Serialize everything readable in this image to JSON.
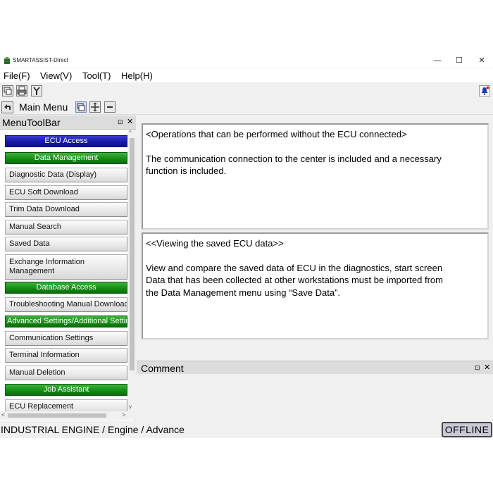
{
  "window": {
    "title": "SMARTASSIST-Direct",
    "controls": {
      "minimize": "—",
      "maximize": "☐",
      "close": "✕"
    }
  },
  "menubar": {
    "items": [
      "File(F)",
      "View(V)",
      "Tool(T)",
      "Help(H)"
    ]
  },
  "toolbar": {
    "main_menu_label": "Main Menu"
  },
  "menu_toolbar": {
    "title": "MenuToolBar",
    "items": [
      {
        "label": "ECU Access",
        "style": "blue"
      },
      {
        "label": "Data Management",
        "style": "green"
      },
      {
        "label": "Diagnostic Data (Display)",
        "style": "grey"
      },
      {
        "label": "ECU Soft Download",
        "style": "grey"
      },
      {
        "label": "Trim Data Download",
        "style": "grey"
      },
      {
        "label": "Manual Search",
        "style": "grey"
      },
      {
        "label": "Saved Data",
        "style": "grey"
      },
      {
        "label": "Exchange Information Management",
        "style": "grey-tall"
      },
      {
        "label": "Database Access",
        "style": "green"
      },
      {
        "label": "Troubleshooting Manual Download",
        "style": "grey"
      },
      {
        "label": "Advanced Settings/Additional Settings",
        "style": "green-left"
      },
      {
        "label": "Communication Settings",
        "style": "grey"
      },
      {
        "label": "Terminal Information",
        "style": "grey"
      },
      {
        "label": "Manual Deletion",
        "style": "grey"
      },
      {
        "label": "Job Assistant",
        "style": "green"
      },
      {
        "label": "ECU Replacement",
        "style": "grey"
      }
    ]
  },
  "content": {
    "box1": {
      "heading": "<Operations that can be performed without the ECU connected>",
      "lines": [
        "The communication connection to the center is included and a necessary",
        "function is included."
      ]
    },
    "box2": {
      "heading": "<<Viewing the saved ECU data>>",
      "lines": [
        "View and compare the saved data of ECU in the diagnostics, start screen",
        "Data that has been collected at other workstations must be imported from",
        "the Data Management menu using “Save Data”."
      ]
    }
  },
  "comment_panel": {
    "title": "Comment"
  },
  "statusbar": {
    "path": "INDUSTRIAL ENGINE / Engine / Advance",
    "status": "OFFLINE"
  },
  "colors": {
    "blue_item": "#1818a8",
    "green_item": "#138f13",
    "background": "#f0f0f0"
  }
}
